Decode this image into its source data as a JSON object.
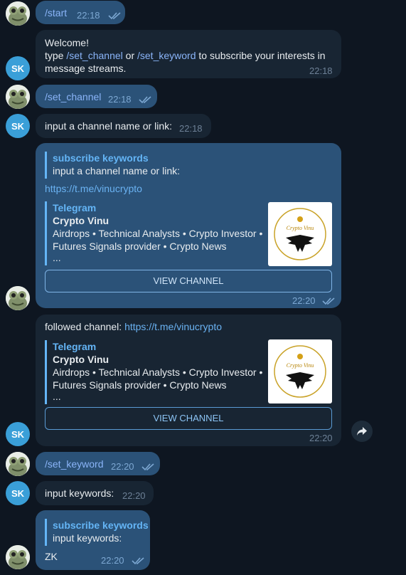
{
  "messages": {
    "m1": {
      "text": "/start",
      "time": "22:18"
    },
    "m2": {
      "line1": "Welcome!",
      "line2_pre": "type ",
      "cmd1": "/set_channel",
      "or": " or ",
      "cmd2": "/set_keyword",
      "line2_post": " to subscribe your interests in",
      "line3": "message streams.",
      "time": "22:18"
    },
    "m3": {
      "text": "/set_channel",
      "time": "22:18"
    },
    "m4": {
      "text": "input a channel name or link:",
      "time": "22:18"
    },
    "m5": {
      "quote_title": "subscribe keywords",
      "quote_text": "input a channel name or link:",
      "link": "https://t.me/vinucrypto",
      "preview_site": "Telegram",
      "preview_title": "Crypto Vinu",
      "preview_desc1": "Airdrops • Technical Analysts • Crypto Investor •",
      "preview_desc2": "Futures Signals provider • Crypto News",
      "preview_more": "...",
      "button": "VIEW CHANNEL",
      "time": "22:20"
    },
    "m6": {
      "prefix": "followed channel: ",
      "link": "https://t.me/vinucrypto",
      "preview_site": "Telegram",
      "preview_title": "Crypto Vinu",
      "preview_desc1": "Airdrops • Technical Analysts • Crypto Investor •",
      "preview_desc2": "Futures Signals provider • Crypto News",
      "preview_more": "...",
      "button": "VIEW CHANNEL",
      "time": "22:20"
    },
    "m7": {
      "text": "/set_keyword",
      "time": "22:20"
    },
    "m8": {
      "text": "input keywords:",
      "time": "22:20"
    },
    "m9": {
      "quote_title": "subscribe keywords",
      "quote_text": "input keywords:",
      "text": "ZK",
      "time": "22:20"
    }
  },
  "avatars": {
    "bot_initials": "SK"
  },
  "thumb_logo_text": "Crypto Vinu",
  "colors": {
    "background": "#0e1621",
    "outgoing": "#2b5278",
    "incoming": "#182533",
    "accent": "#64b5f6"
  }
}
